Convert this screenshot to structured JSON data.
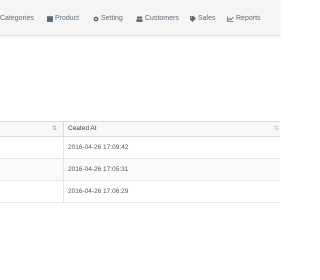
{
  "nav": {
    "items": [
      {
        "label": "Categories",
        "icon": "list-icon"
      },
      {
        "label": "Product",
        "icon": "box-icon"
      },
      {
        "label": "Setting",
        "icon": "gear-icon"
      },
      {
        "label": "Customers",
        "icon": "users-icon"
      },
      {
        "label": "Sales",
        "icon": "tag-icon"
      },
      {
        "label": "Reports",
        "icon": "line-chart-icon"
      }
    ]
  },
  "table": {
    "columns": [
      {
        "label": ""
      },
      {
        "label": "Ceated At"
      }
    ],
    "rows": [
      {
        "created_at": "2016-04-26 17:09:42"
      },
      {
        "created_at": "2016-04-26 17:05:31"
      },
      {
        "created_at": "2016-04-26 17:06:29"
      }
    ]
  },
  "colors": {
    "navbar_bg": "#f5f5f5",
    "nav_text": "#5f6b77",
    "header_bg": "#f7f8fa",
    "border": "#d8dde3"
  }
}
